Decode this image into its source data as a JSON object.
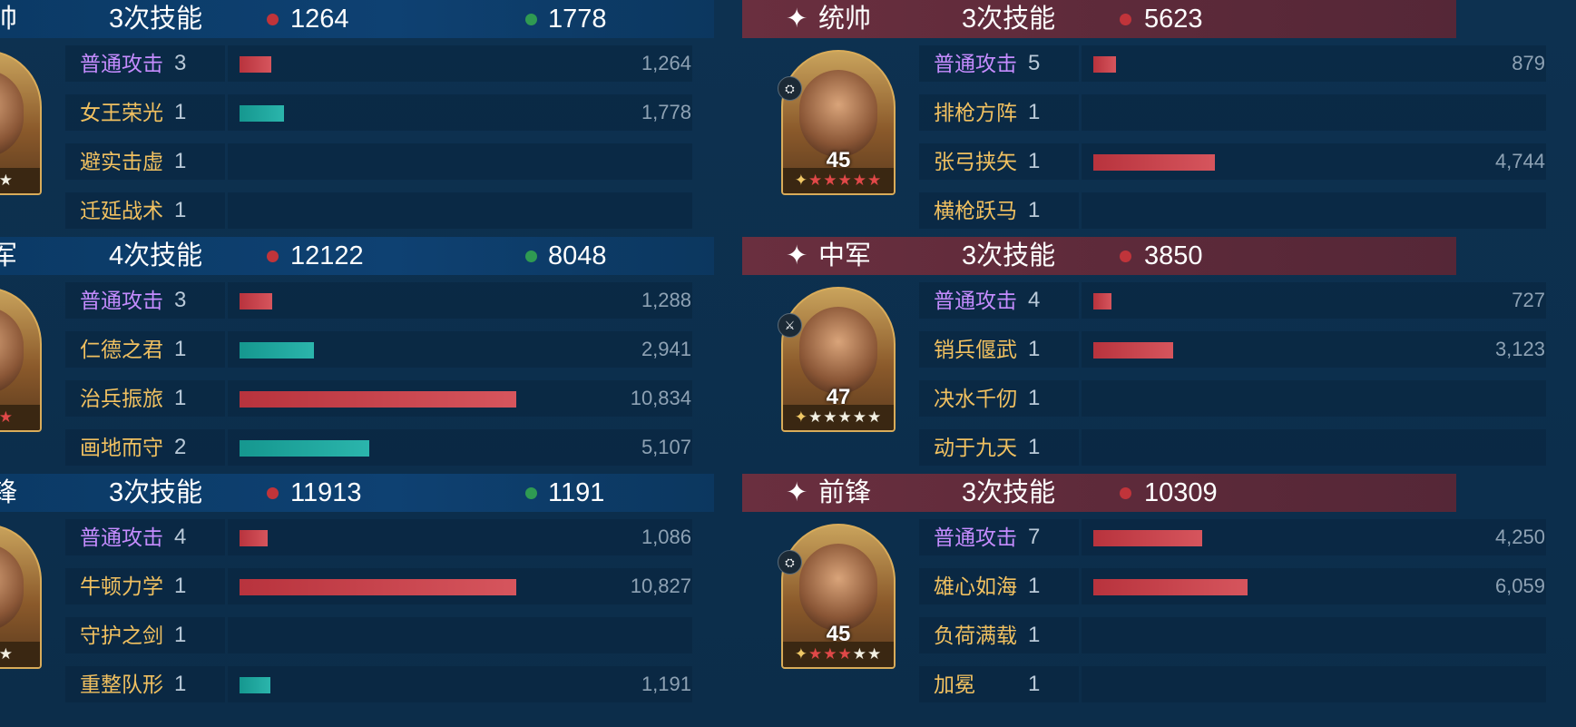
{
  "left": {
    "sections": [
      {
        "role": "帅",
        "skill_count": "3次技能",
        "damage": "1264",
        "heal": "1778",
        "level": "",
        "stars": {
          "red": 0,
          "white": 3
        },
        "skills": [
          {
            "name": "普通攻击",
            "uses": "3",
            "value": "1,264",
            "fraction": 0.114,
            "color": "red",
            "basic": true
          },
          {
            "name": "女王荣光",
            "uses": "1",
            "value": "1,778",
            "fraction": 0.16,
            "color": "teal",
            "basic": false
          },
          {
            "name": "避实击虚",
            "uses": "1",
            "value": "",
            "fraction": 0,
            "color": "red",
            "basic": false
          },
          {
            "name": "迁延战术",
            "uses": "1",
            "value": "",
            "fraction": 0,
            "color": "red",
            "basic": false
          }
        ]
      },
      {
        "role": "军",
        "skill_count": "4次技能",
        "damage": "12122",
        "heal": "8048",
        "level": "",
        "stars": {
          "red": 3,
          "white": 0
        },
        "skills": [
          {
            "name": "普通攻击",
            "uses": "3",
            "value": "1,288",
            "fraction": 0.118,
            "color": "red",
            "basic": true
          },
          {
            "name": "仁德之君",
            "uses": "1",
            "value": "2,941",
            "fraction": 0.27,
            "color": "teal",
            "basic": false
          },
          {
            "name": "治兵振旅",
            "uses": "1",
            "value": "10,834",
            "fraction": 1.0,
            "color": "red",
            "basic": false
          },
          {
            "name": "画地而守",
            "uses": "2",
            "value": "5,107",
            "fraction": 0.47,
            "color": "teal",
            "basic": false
          }
        ]
      },
      {
        "role": "锋",
        "skill_count": "3次技能",
        "damage": "11913",
        "heal": "1191",
        "level": "",
        "stars": {
          "red": 0,
          "white": 3
        },
        "skills": [
          {
            "name": "普通攻击",
            "uses": "4",
            "value": "1,086",
            "fraction": 0.1,
            "color": "red",
            "basic": true
          },
          {
            "name": "牛顿力学",
            "uses": "1",
            "value": "10,827",
            "fraction": 1.0,
            "color": "red",
            "basic": false
          },
          {
            "name": "守护之剑",
            "uses": "1",
            "value": "",
            "fraction": 0,
            "color": "red",
            "basic": false
          },
          {
            "name": "重整队形",
            "uses": "1",
            "value": "1,191",
            "fraction": 0.11,
            "color": "teal",
            "basic": false
          }
        ]
      }
    ]
  },
  "right": {
    "sections": [
      {
        "role": "统帅",
        "skill_count": "3次技能",
        "damage": "5623",
        "level": "45",
        "stars": {
          "red": 5,
          "white": 0
        },
        "badge": "tank-icon",
        "skills": [
          {
            "name": "普通攻击",
            "uses": "5",
            "value": "879",
            "fraction": 0.081,
            "color": "red",
            "basic": true
          },
          {
            "name": "排枪方阵",
            "uses": "1",
            "value": "",
            "fraction": 0,
            "color": "red",
            "basic": false
          },
          {
            "name": "张弓挟矢",
            "uses": "1",
            "value": "4,744",
            "fraction": 0.438,
            "color": "red",
            "basic": false
          },
          {
            "name": "横枪跃马",
            "uses": "1",
            "value": "",
            "fraction": 0,
            "color": "red",
            "basic": false
          }
        ]
      },
      {
        "role": "中军",
        "skill_count": "3次技能",
        "damage": "3850",
        "level": "47",
        "stars": {
          "red": 0,
          "white": 5
        },
        "badge": "sword-icon",
        "skills": [
          {
            "name": "普通攻击",
            "uses": "4",
            "value": "727",
            "fraction": 0.067,
            "color": "red",
            "basic": true
          },
          {
            "name": "销兵偃武",
            "uses": "1",
            "value": "3,123",
            "fraction": 0.288,
            "color": "red",
            "basic": false
          },
          {
            "name": "决水千仞",
            "uses": "1",
            "value": "",
            "fraction": 0,
            "color": "red",
            "basic": false
          },
          {
            "name": "动于九天",
            "uses": "1",
            "value": "",
            "fraction": 0,
            "color": "red",
            "basic": false
          }
        ]
      },
      {
        "role": "前锋",
        "skill_count": "3次技能",
        "damage": "10309",
        "level": "45",
        "stars": {
          "red": 3,
          "white": 2
        },
        "badge": "tank-icon",
        "skills": [
          {
            "name": "普通攻击",
            "uses": "7",
            "value": "4,250",
            "fraction": 0.392,
            "color": "red",
            "basic": true
          },
          {
            "name": "雄心如海",
            "uses": "1",
            "value": "6,059",
            "fraction": 0.559,
            "color": "red",
            "basic": false
          },
          {
            "name": "负荷满载",
            "uses": "1",
            "value": "",
            "fraction": 0,
            "color": "red",
            "basic": false
          },
          {
            "name": "加冕",
            "uses": "1",
            "value": "",
            "fraction": 0,
            "color": "red",
            "basic": false
          }
        ]
      }
    ]
  },
  "icons": {
    "leader_marker": "✦"
  }
}
